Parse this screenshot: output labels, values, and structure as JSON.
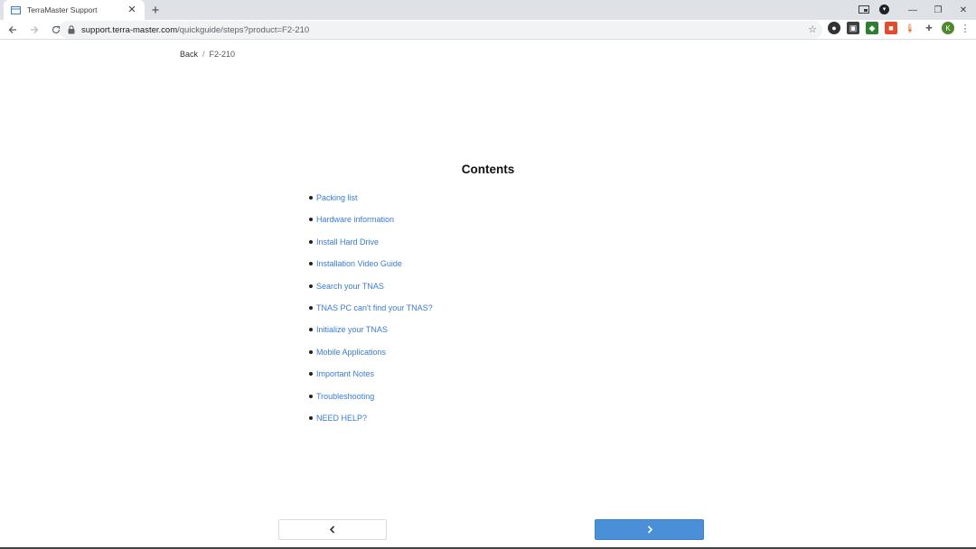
{
  "browser": {
    "tab": {
      "title": "TerraMaster Support"
    },
    "url": {
      "host": "support.terra-master.com",
      "path": "/quickguide/steps?product=F2-210"
    },
    "profile_initial": "K",
    "icons": {
      "back": "arrow-left-icon",
      "forward": "arrow-right-icon",
      "reload": "reload-icon",
      "lock": "lock-icon",
      "star": "star-icon",
      "extensions": "puzzle-icon",
      "menu": "kebab-menu-icon"
    }
  },
  "breadcrumb": {
    "back_label": "Back",
    "separator": "/",
    "current": "F2-210"
  },
  "contents": {
    "title": "Contents",
    "items": [
      "Packing list",
      "Hardware information",
      "Install Hard Drive",
      "Installation Video Guide",
      "Search your TNAS",
      "TNAS PC can't find your TNAS?",
      "Initialize your TNAS",
      "Mobile Applications",
      "Important Notes",
      "Troubleshooting",
      "NEED HELP?"
    ]
  },
  "colors": {
    "link": "#3a7bd5",
    "next_button": "#4a90d9"
  }
}
